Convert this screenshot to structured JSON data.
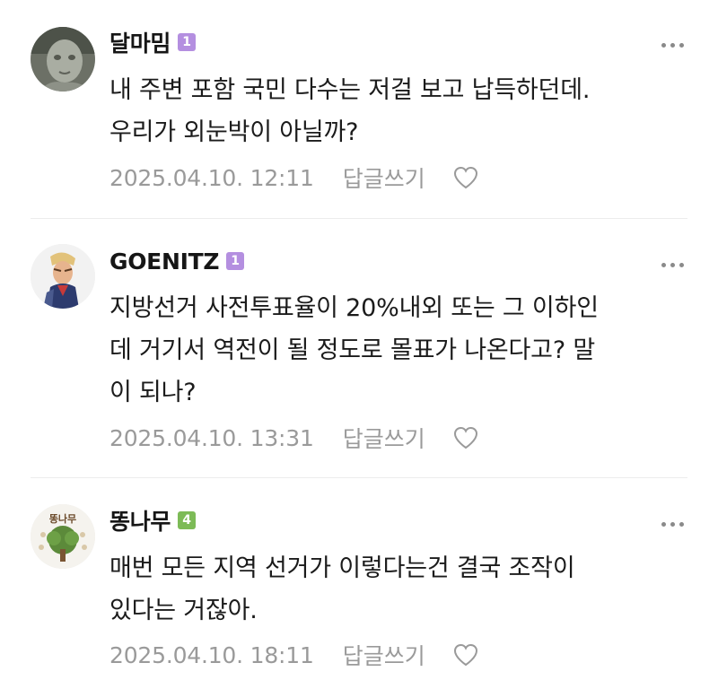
{
  "comments": [
    {
      "author": "달마밈",
      "level": "1",
      "level_color": "#b48fe0",
      "text": "내 주변 포함 국민 다수는 저걸 보고 납득하던데.\n우리가 외눈박이 아닐까?",
      "timestamp": "2025.04.10. 12:11",
      "reply_label": "답글쓰기",
      "avatar_icon": "statue-face-avatar"
    },
    {
      "author": "GOENITZ",
      "level": "1",
      "level_color": "#b48fe0",
      "text": "지방선거 사전투표율이 20%내외 또는 그 이하인\n데 거기서 역전이 될 정도로 몰표가 나온다고? 말\n이 되나?",
      "timestamp": "2025.04.10. 13:31",
      "reply_label": "답글쓰기",
      "avatar_icon": "anime-character-avatar"
    },
    {
      "author": "똥나무",
      "level": "4",
      "level_color": "#7dbb57",
      "text": "매번 모든 지역 선거가 이렇다는건 결국 조작이\n있다는 거잖아.",
      "timestamp": "2025.04.10. 18:11",
      "reply_label": "답글쓰기",
      "avatar_icon": "tree-logo-avatar",
      "avatar_logo_text": "똥나무"
    }
  ],
  "icons": {
    "more": "more-options-icon",
    "like": "heart-outline-icon"
  }
}
